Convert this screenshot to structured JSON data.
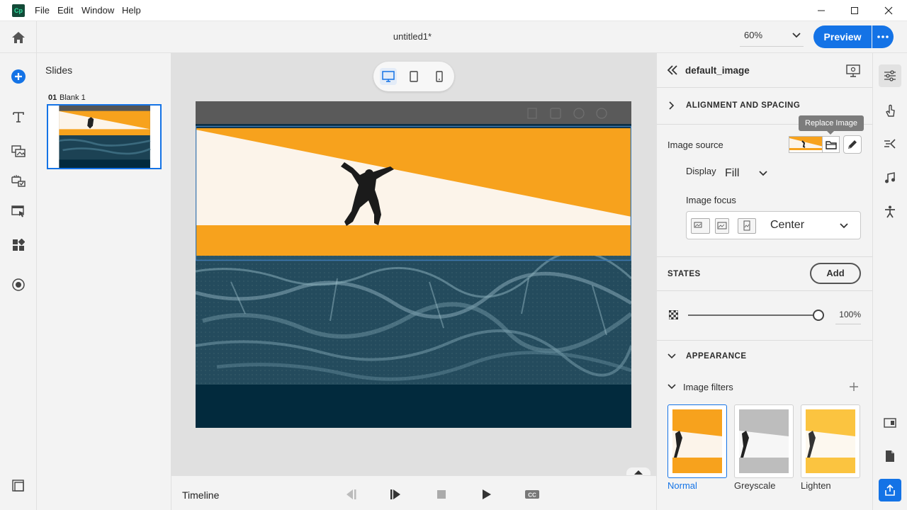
{
  "app": {
    "logo_text": "Cp",
    "menu": [
      "File",
      "Edit",
      "Window",
      "Help"
    ]
  },
  "header": {
    "doc_title": "untitled1*",
    "zoom": "60%",
    "preview_label": "Preview"
  },
  "slides_panel": {
    "title": "Slides",
    "slides": [
      {
        "number": "01",
        "name": "Blank 1"
      }
    ]
  },
  "timeline": {
    "label": "Timeline"
  },
  "properties": {
    "element_name": "default_image",
    "alignment_section": "ALIGNMENT AND SPACING",
    "tooltip": "Replace Image",
    "image_source_label": "Image source",
    "display_label": "Display",
    "display_value": "Fill",
    "image_focus_label": "Image focus",
    "image_focus_value": "Center",
    "states_title": "STATES",
    "add_state_label": "Add",
    "opacity_value": "100%",
    "appearance_title": "APPEARANCE",
    "image_filters_label": "Image filters",
    "filters": [
      {
        "label": "Normal",
        "color": "#f7a21d",
        "selected": true
      },
      {
        "label": "Greyscale",
        "color": "#bdbdbd",
        "selected": false
      },
      {
        "label": "Lighten",
        "color": "#fbc440",
        "selected": false
      }
    ]
  },
  "colors": {
    "accent": "#1473e6",
    "orange": "#f7a21d",
    "cream": "#fcf4ea",
    "sea_dark": "#022a3d",
    "sea": "#1f4a5c"
  }
}
